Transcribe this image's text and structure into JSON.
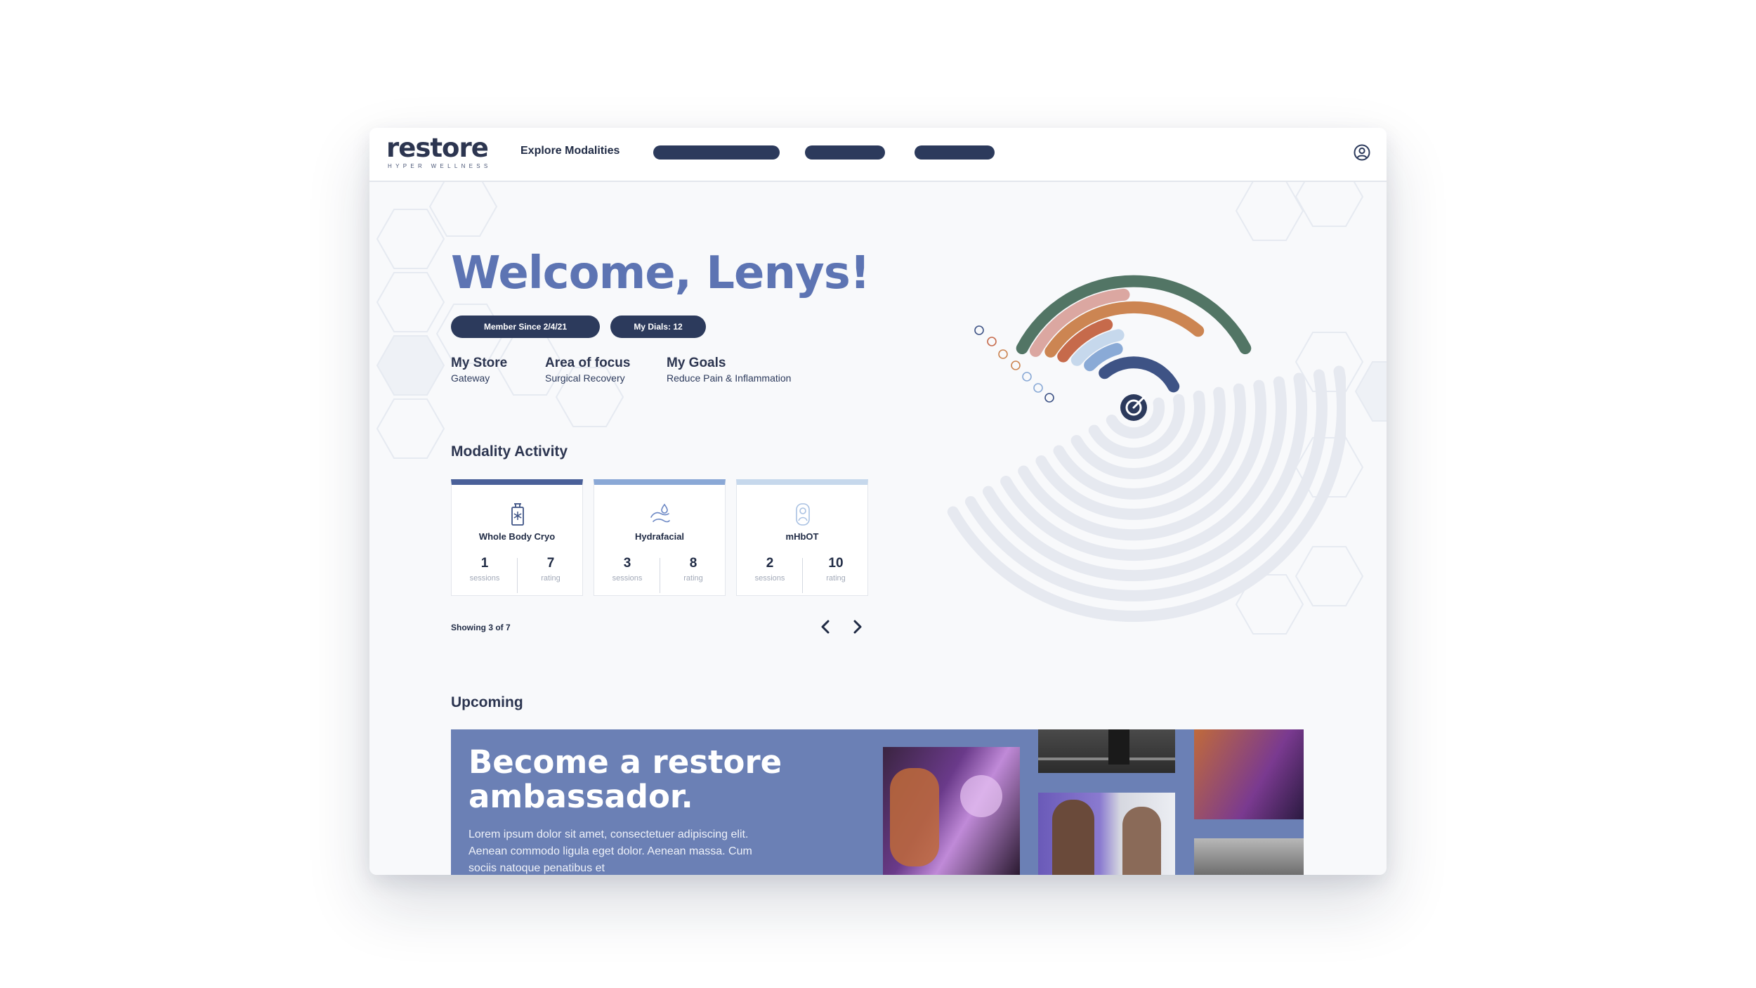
{
  "brand": {
    "logo_text": "restore",
    "logo_tagline": "HYPER WELLNESS"
  },
  "nav": {
    "explore": "Explore Modalities",
    "profile_icon": "user-circle-icon"
  },
  "hero": {
    "welcome": "Welcome, Lenys!",
    "member_since": "Member Since 2/4/21",
    "dials": "My Dials: 12",
    "store_label": "My Store",
    "store_value": "Gateway",
    "focus_label": "Area of focus",
    "focus_value": "Surgical Recovery",
    "goals_label": "My Goals",
    "goals_value": "Reduce Pain & Inflammation"
  },
  "dial": {
    "colors": [
      "#527565",
      "#dba7a1",
      "#cc8552",
      "#c66a4b",
      "#c6d8ec",
      "#8aaad6",
      "#3e5385"
    ],
    "icon_names": [
      "molecule-icon",
      "heart-icon",
      "flame-icon",
      "lightbulb-icon",
      "face-icon",
      "droplet-icon",
      "snowflake-icon",
      "target-icon"
    ]
  },
  "activity": {
    "title": "Modality Activity",
    "cards": [
      {
        "name": "Whole Body Cryo",
        "sessions": "1",
        "sessions_label": "sessions",
        "rating": "7",
        "rating_label": "rating",
        "accent": "#4a6099",
        "icon": "cryo-chamber-icon"
      },
      {
        "name": "Hydrafacial",
        "sessions": "3",
        "sessions_label": "sessions",
        "rating": "8",
        "rating_label": "rating",
        "accent": "#8aa8d6",
        "icon": "hydrafacial-icon"
      },
      {
        "name": "mHbOT",
        "sessions": "2",
        "sessions_label": "sessions",
        "rating": "10",
        "rating_label": "rating",
        "accent": "#c6d8ec",
        "icon": "oxygen-chamber-icon"
      }
    ],
    "showing": "Showing 3 of 7",
    "prev_icon": "chevron-left-icon",
    "next_icon": "chevron-right-icon"
  },
  "upcoming": {
    "title": "Upcoming",
    "banner_title": "Become a restore ambassador.",
    "banner_text": "Lorem ipsum dolor sit amet, consectetuer adipiscing elit. Aenean commodo ligula eget dolor. Aenean massa. Cum sociis natoque penatibus et"
  },
  "colors": {
    "navy": "#2c3a5c",
    "welcome_blue": "#5d74b3",
    "banner_blue": "#6b80b5"
  }
}
